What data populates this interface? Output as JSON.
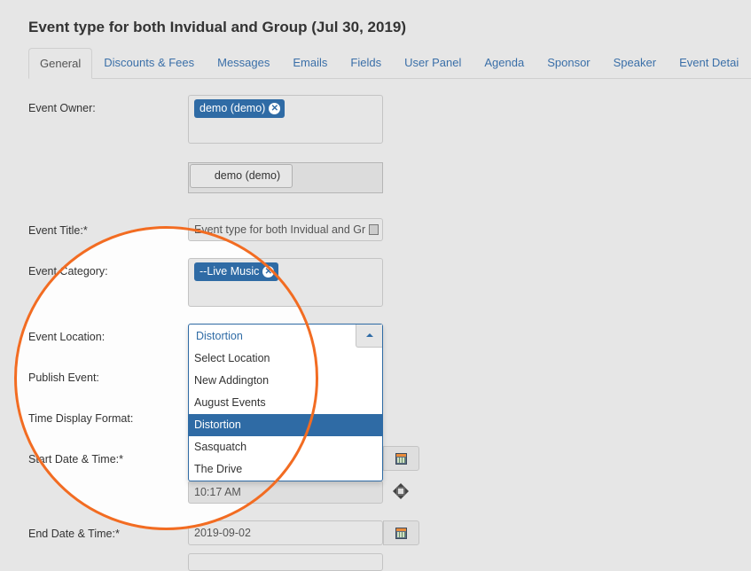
{
  "page": {
    "title": "Event type for both Invidual and Group (Jul 30, 2019)"
  },
  "tabs": [
    {
      "label": "General",
      "active": true
    },
    {
      "label": "Discounts & Fees"
    },
    {
      "label": "Messages"
    },
    {
      "label": "Emails"
    },
    {
      "label": "Fields"
    },
    {
      "label": "User Panel"
    },
    {
      "label": "Agenda"
    },
    {
      "label": "Sponsor"
    },
    {
      "label": "Speaker"
    },
    {
      "label": "Event Detai"
    }
  ],
  "form": {
    "event_owner": {
      "label": "Event Owner:",
      "tag": "demo (demo)",
      "remove_icon": "x-circle-icon",
      "selected_button": "demo (demo)"
    },
    "event_title": {
      "label": "Event Title:*",
      "value": "Event type for both Invidual and Gr"
    },
    "event_category": {
      "label": "Event Category:",
      "tag": "--Live Music"
    },
    "event_location": {
      "label": "Event Location:",
      "selected": "Distortion",
      "options": [
        "Select Location",
        "New Addington",
        "August Events",
        "Distortion",
        "Sasquatch",
        "The Drive"
      ],
      "highlighted_index": 3
    },
    "publish_event": {
      "label": "Publish Event:"
    },
    "time_display_format": {
      "label": "Time Display Format:"
    },
    "start_date_time": {
      "label": "Start Date & Time:*",
      "time": "10:17 AM",
      "calendar_icon": "calendar-icon",
      "move_icon": "move-icon"
    },
    "end_date_time": {
      "label": "End Date & Time:*",
      "date": "2019-09-02",
      "calendar_icon": "calendar-icon"
    }
  },
  "colors": {
    "accent": "#2f6ba5",
    "highlight_ring": "#f26c22",
    "background": "#e6e6e6"
  }
}
